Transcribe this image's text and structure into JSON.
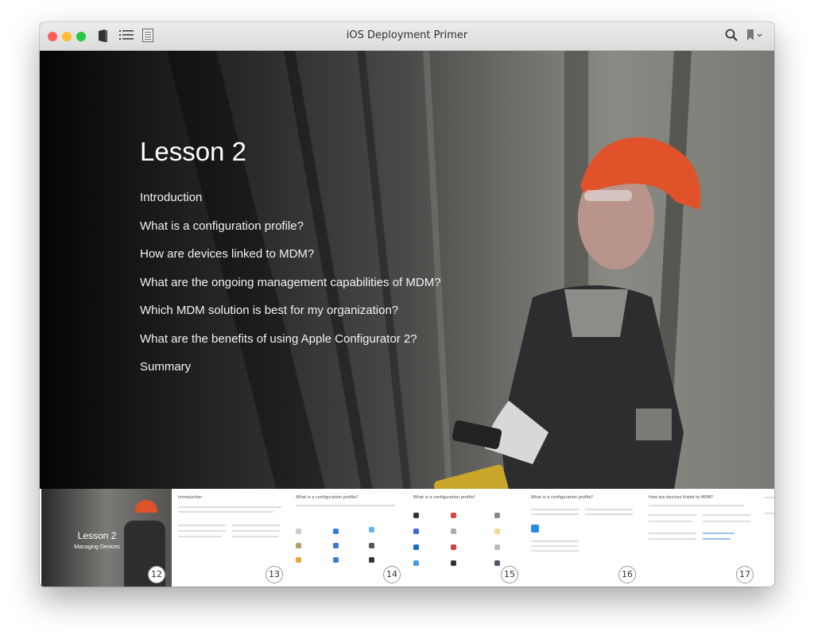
{
  "window": {
    "title": "iOS Deployment Primer"
  },
  "toolbar": {
    "icons": [
      "library-icon",
      "table-of-contents-icon",
      "notes-icon",
      "search-icon",
      "bookmark-icon"
    ]
  },
  "lesson": {
    "title": "Lesson 2",
    "items": [
      "Introduction",
      "What is a configuration profile?",
      "How are devices linked to MDM?",
      "What are the ongoing management capabilities of MDM?",
      "Which MDM solution is best for my organization?",
      "What are the benefits of using Apple Configurator 2?",
      "Summary"
    ]
  },
  "thumbnails": [
    {
      "page": "12",
      "title": "Lesson 2",
      "subtitle": "Managing Devices"
    },
    {
      "page": "13",
      "title": "Introduction"
    },
    {
      "page": "14",
      "title": "What is a configuration profile?"
    },
    {
      "page": "15",
      "title": "What is a configuration profile?"
    },
    {
      "page": "16",
      "title": "What is a configuration profile?"
    },
    {
      "page": "17",
      "title": "How are devices linked to MDM?"
    }
  ],
  "colors": {
    "close": "#fe5f57",
    "minimize": "#febc2e",
    "zoom": "#28c840",
    "helmet": "#e0522a"
  }
}
